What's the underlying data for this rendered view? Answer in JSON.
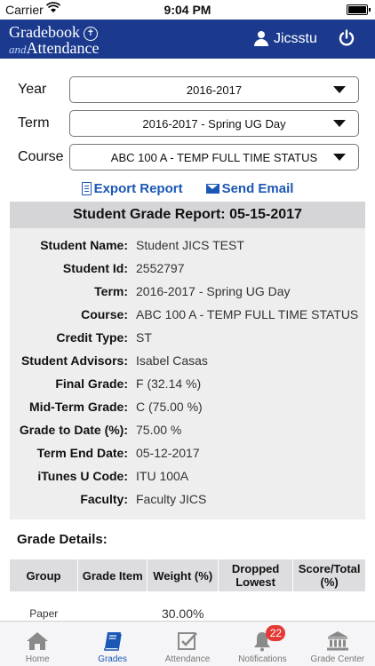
{
  "status": {
    "carrier": "Carrier",
    "time": "9:04 PM",
    "battery_level": 1.0
  },
  "header": {
    "logo_line1": "Gradebook",
    "logo_and": "and",
    "logo_line2": "Attendance",
    "username": "Jicsstu"
  },
  "filters": [
    {
      "label": "Year",
      "value": "2016-2017"
    },
    {
      "label": "Term",
      "value": "2016-2017 - Spring UG Day"
    },
    {
      "label": "Course",
      "value": "ABC  100  A - TEMP FULL TIME STATUS"
    }
  ],
  "actions": {
    "export": "Export Report",
    "email": "Send Email"
  },
  "report": {
    "title": "Student Grade Report: 05-15-2017",
    "fields": [
      {
        "label": "Student Name:",
        "value": "Student JICS TEST"
      },
      {
        "label": "Student Id:",
        "value": "2552797"
      },
      {
        "label": "Term:",
        "value": "2016-2017 - Spring UG Day"
      },
      {
        "label": "Course:",
        "value": "ABC  100  A - TEMP FULL TIME STATUS"
      },
      {
        "label": "Credit Type:",
        "value": "ST"
      },
      {
        "label": "Student Advisors:",
        "value": "Isabel Casas"
      },
      {
        "label": "Final Grade:",
        "value": "F (32.14 %)"
      },
      {
        "label": "Mid-Term Grade:",
        "value": "C (75.00 %)"
      },
      {
        "label": "Grade to Date (%):",
        "value": "75.00 %"
      },
      {
        "label": "Term End Date:",
        "value": "05-12-2017"
      },
      {
        "label": "iTunes U Code:",
        "value": "ITU 100A"
      },
      {
        "label": "Faculty:",
        "value": "Faculty JICS"
      }
    ]
  },
  "grade_details": {
    "title": "Grade Details:",
    "columns": [
      "Group",
      "Grade Item",
      "Weight (%)",
      "Dropped Lowest",
      "Score/Total (%)"
    ],
    "rows": [
      [
        "Paper",
        "",
        "30.00%",
        "",
        ""
      ]
    ]
  },
  "tabs": [
    {
      "label": "Home",
      "icon": "home-icon"
    },
    {
      "label": "Grades",
      "icon": "book-icon"
    },
    {
      "label": "Attendance",
      "icon": "checklist-icon"
    },
    {
      "label": "Notifications",
      "icon": "bell-icon",
      "badge": "22"
    },
    {
      "label": "Grade Center",
      "icon": "bank-icon"
    }
  ],
  "colors": {
    "header": "#1b3a8e",
    "accent": "#1b57b5",
    "badge": "#e53935"
  }
}
